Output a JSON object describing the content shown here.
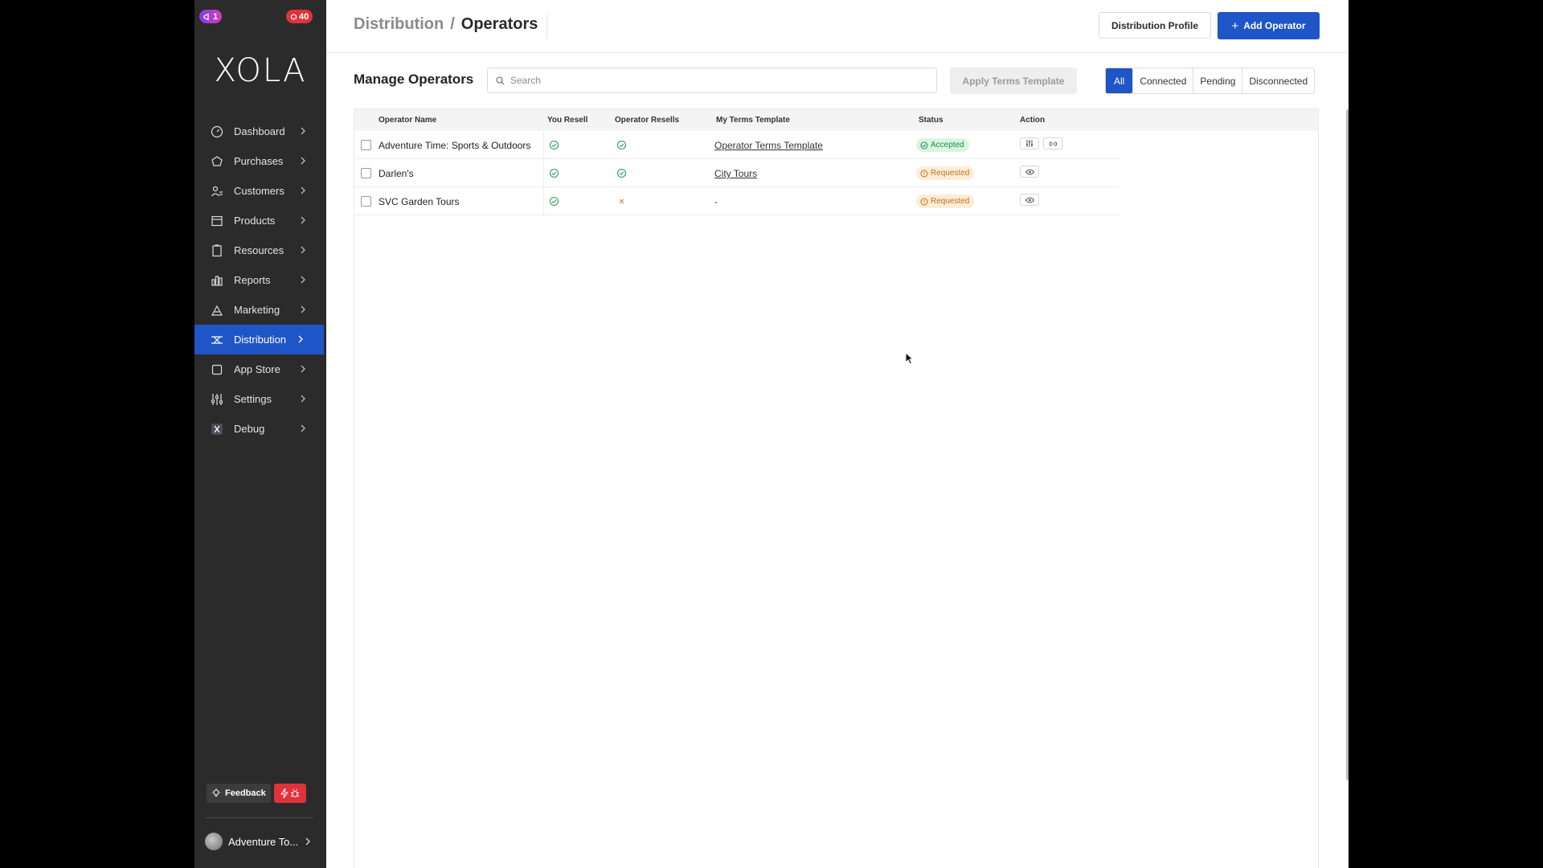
{
  "sidebar": {
    "badge_left": "1",
    "badge_right": "40",
    "logo": "XOLA",
    "items": [
      {
        "label": "Dashboard",
        "icon": "dashboard-icon"
      },
      {
        "label": "Purchases",
        "icon": "purchases-icon"
      },
      {
        "label": "Customers",
        "icon": "customers-icon"
      },
      {
        "label": "Products",
        "icon": "products-icon"
      },
      {
        "label": "Resources",
        "icon": "resources-icon"
      },
      {
        "label": "Reports",
        "icon": "reports-icon"
      },
      {
        "label": "Marketing",
        "icon": "marketing-icon"
      },
      {
        "label": "Distribution",
        "icon": "distribution-icon",
        "active": true
      },
      {
        "label": "App Store",
        "icon": "app-store-icon"
      },
      {
        "label": "Settings",
        "icon": "settings-icon"
      },
      {
        "label": "Debug",
        "icon": "debug-icon"
      }
    ],
    "feedback_label": "Feedback",
    "account_name": "Adventure To..."
  },
  "header": {
    "breadcrumb_parent": "Distribution",
    "breadcrumb_sep": "/",
    "breadcrumb_current": "Operators",
    "profile_button": "Distribution Profile",
    "add_button": "Add Operator"
  },
  "main": {
    "title": "Manage Operators",
    "search_placeholder": "Search",
    "apply_button": "Apply Terms Template",
    "filters": [
      "All",
      "Connected",
      "Pending",
      "Disconnected"
    ],
    "active_filter": "All",
    "columns": [
      "Operator Name",
      "You Resell",
      "Operator Resells",
      "My Terms Template",
      "Status",
      "Action"
    ],
    "rows": [
      {
        "name": "Adventure Time: Sports & Outdoors",
        "you_resell": true,
        "operator_resells": true,
        "template": "Operator Terms Template",
        "status": "Accepted",
        "actions": [
          "sliders-icon",
          "link-icon"
        ]
      },
      {
        "name": "Darlen's",
        "you_resell": true,
        "operator_resells": true,
        "template": "City Tours",
        "status": "Requested",
        "actions": [
          "eye-icon"
        ]
      },
      {
        "name": "SVC Garden Tours",
        "you_resell": true,
        "operator_resells": false,
        "template": "-",
        "status": "Requested",
        "actions": [
          "eye-icon"
        ]
      }
    ]
  },
  "colors": {
    "accent": "#1f55c6",
    "sidebar_bg": "#2b2b2b",
    "accepted_bg": "#d8f5e2",
    "accepted_text": "#1f8a4a",
    "requested_bg": "#fdecd6",
    "requested_text": "#c0741d",
    "danger": "#e0323a"
  }
}
